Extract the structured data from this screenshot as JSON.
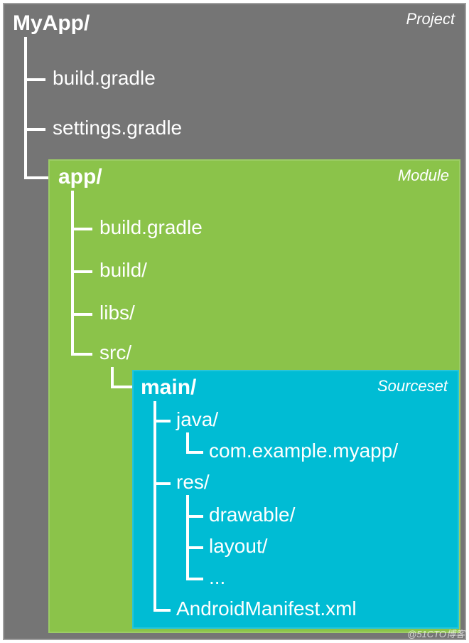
{
  "project": {
    "tag": "Project",
    "root": "MyApp/",
    "items": [
      "build.gradle",
      "settings.gradle"
    ]
  },
  "module": {
    "tag": "Module",
    "root": "app/",
    "items": [
      "build.gradle",
      "build/",
      "libs/",
      "src/"
    ]
  },
  "srcset": {
    "tag": "Sourceset",
    "root": "main/",
    "java": {
      "label": "java/",
      "child": "com.example.myapp/"
    },
    "res": {
      "label": "res/",
      "children": [
        "drawable/",
        "layout/",
        "..."
      ]
    },
    "manifest": "AndroidManifest.xml"
  },
  "watermark": "@51CTO博客"
}
